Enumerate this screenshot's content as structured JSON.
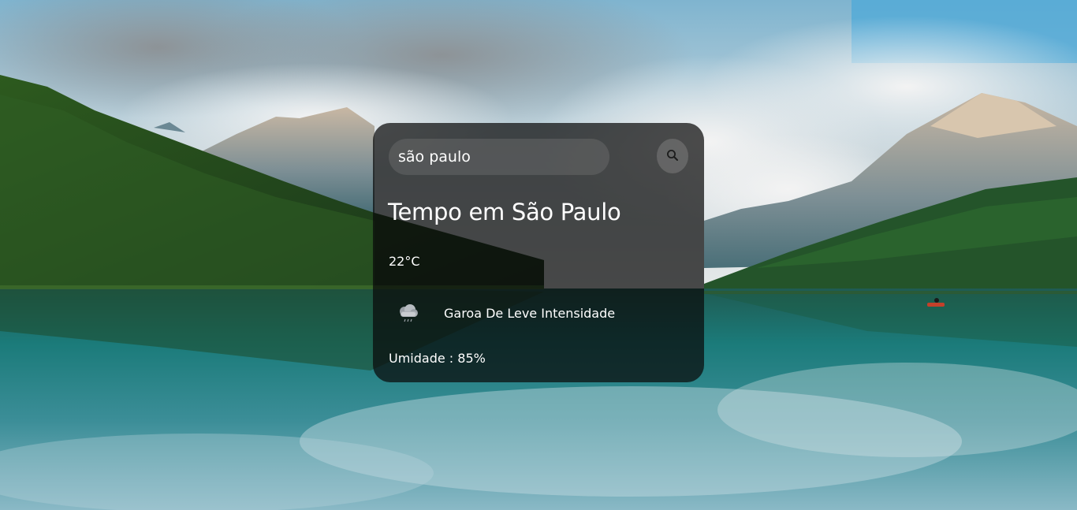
{
  "search": {
    "value": "são paulo",
    "button_icon": "search-icon"
  },
  "weather": {
    "title_prefix": "Tempo em",
    "city": "São Paulo",
    "title": "Tempo em São Paulo",
    "temperature": "22°C",
    "icon": "drizzle-cloud-icon",
    "description": "Garoa De Leve Intensidade",
    "humidity_label": "Umidade",
    "humidity_value": "85%"
  },
  "colors": {
    "card_background": "#0a0a0ab8",
    "text": "#ffffff",
    "sky": "#4aa8d8",
    "water": "#1f7f7e",
    "forest": "#1f4a1c"
  }
}
